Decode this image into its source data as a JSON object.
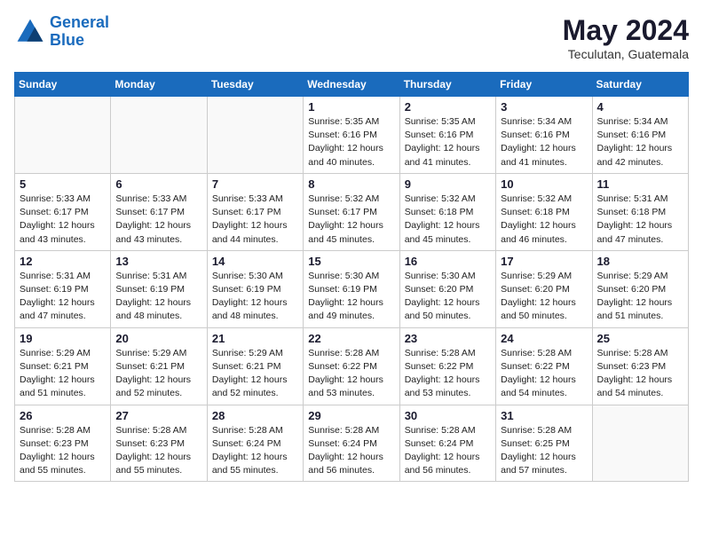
{
  "header": {
    "logo_line1": "General",
    "logo_line2": "Blue",
    "month": "May 2024",
    "location": "Teculutan, Guatemala"
  },
  "weekdays": [
    "Sunday",
    "Monday",
    "Tuesday",
    "Wednesday",
    "Thursday",
    "Friday",
    "Saturday"
  ],
  "weeks": [
    [
      {
        "day": "",
        "info": ""
      },
      {
        "day": "",
        "info": ""
      },
      {
        "day": "",
        "info": ""
      },
      {
        "day": "1",
        "info": "Sunrise: 5:35 AM\nSunset: 6:16 PM\nDaylight: 12 hours\nand 40 minutes."
      },
      {
        "day": "2",
        "info": "Sunrise: 5:35 AM\nSunset: 6:16 PM\nDaylight: 12 hours\nand 41 minutes."
      },
      {
        "day": "3",
        "info": "Sunrise: 5:34 AM\nSunset: 6:16 PM\nDaylight: 12 hours\nand 41 minutes."
      },
      {
        "day": "4",
        "info": "Sunrise: 5:34 AM\nSunset: 6:16 PM\nDaylight: 12 hours\nand 42 minutes."
      }
    ],
    [
      {
        "day": "5",
        "info": "Sunrise: 5:33 AM\nSunset: 6:17 PM\nDaylight: 12 hours\nand 43 minutes."
      },
      {
        "day": "6",
        "info": "Sunrise: 5:33 AM\nSunset: 6:17 PM\nDaylight: 12 hours\nand 43 minutes."
      },
      {
        "day": "7",
        "info": "Sunrise: 5:33 AM\nSunset: 6:17 PM\nDaylight: 12 hours\nand 44 minutes."
      },
      {
        "day": "8",
        "info": "Sunrise: 5:32 AM\nSunset: 6:17 PM\nDaylight: 12 hours\nand 45 minutes."
      },
      {
        "day": "9",
        "info": "Sunrise: 5:32 AM\nSunset: 6:18 PM\nDaylight: 12 hours\nand 45 minutes."
      },
      {
        "day": "10",
        "info": "Sunrise: 5:32 AM\nSunset: 6:18 PM\nDaylight: 12 hours\nand 46 minutes."
      },
      {
        "day": "11",
        "info": "Sunrise: 5:31 AM\nSunset: 6:18 PM\nDaylight: 12 hours\nand 47 minutes."
      }
    ],
    [
      {
        "day": "12",
        "info": "Sunrise: 5:31 AM\nSunset: 6:19 PM\nDaylight: 12 hours\nand 47 minutes."
      },
      {
        "day": "13",
        "info": "Sunrise: 5:31 AM\nSunset: 6:19 PM\nDaylight: 12 hours\nand 48 minutes."
      },
      {
        "day": "14",
        "info": "Sunrise: 5:30 AM\nSunset: 6:19 PM\nDaylight: 12 hours\nand 48 minutes."
      },
      {
        "day": "15",
        "info": "Sunrise: 5:30 AM\nSunset: 6:19 PM\nDaylight: 12 hours\nand 49 minutes."
      },
      {
        "day": "16",
        "info": "Sunrise: 5:30 AM\nSunset: 6:20 PM\nDaylight: 12 hours\nand 50 minutes."
      },
      {
        "day": "17",
        "info": "Sunrise: 5:29 AM\nSunset: 6:20 PM\nDaylight: 12 hours\nand 50 minutes."
      },
      {
        "day": "18",
        "info": "Sunrise: 5:29 AM\nSunset: 6:20 PM\nDaylight: 12 hours\nand 51 minutes."
      }
    ],
    [
      {
        "day": "19",
        "info": "Sunrise: 5:29 AM\nSunset: 6:21 PM\nDaylight: 12 hours\nand 51 minutes."
      },
      {
        "day": "20",
        "info": "Sunrise: 5:29 AM\nSunset: 6:21 PM\nDaylight: 12 hours\nand 52 minutes."
      },
      {
        "day": "21",
        "info": "Sunrise: 5:29 AM\nSunset: 6:21 PM\nDaylight: 12 hours\nand 52 minutes."
      },
      {
        "day": "22",
        "info": "Sunrise: 5:28 AM\nSunset: 6:22 PM\nDaylight: 12 hours\nand 53 minutes."
      },
      {
        "day": "23",
        "info": "Sunrise: 5:28 AM\nSunset: 6:22 PM\nDaylight: 12 hours\nand 53 minutes."
      },
      {
        "day": "24",
        "info": "Sunrise: 5:28 AM\nSunset: 6:22 PM\nDaylight: 12 hours\nand 54 minutes."
      },
      {
        "day": "25",
        "info": "Sunrise: 5:28 AM\nSunset: 6:23 PM\nDaylight: 12 hours\nand 54 minutes."
      }
    ],
    [
      {
        "day": "26",
        "info": "Sunrise: 5:28 AM\nSunset: 6:23 PM\nDaylight: 12 hours\nand 55 minutes."
      },
      {
        "day": "27",
        "info": "Sunrise: 5:28 AM\nSunset: 6:23 PM\nDaylight: 12 hours\nand 55 minutes."
      },
      {
        "day": "28",
        "info": "Sunrise: 5:28 AM\nSunset: 6:24 PM\nDaylight: 12 hours\nand 55 minutes."
      },
      {
        "day": "29",
        "info": "Sunrise: 5:28 AM\nSunset: 6:24 PM\nDaylight: 12 hours\nand 56 minutes."
      },
      {
        "day": "30",
        "info": "Sunrise: 5:28 AM\nSunset: 6:24 PM\nDaylight: 12 hours\nand 56 minutes."
      },
      {
        "day": "31",
        "info": "Sunrise: 5:28 AM\nSunset: 6:25 PM\nDaylight: 12 hours\nand 57 minutes."
      },
      {
        "day": "",
        "info": ""
      }
    ]
  ]
}
